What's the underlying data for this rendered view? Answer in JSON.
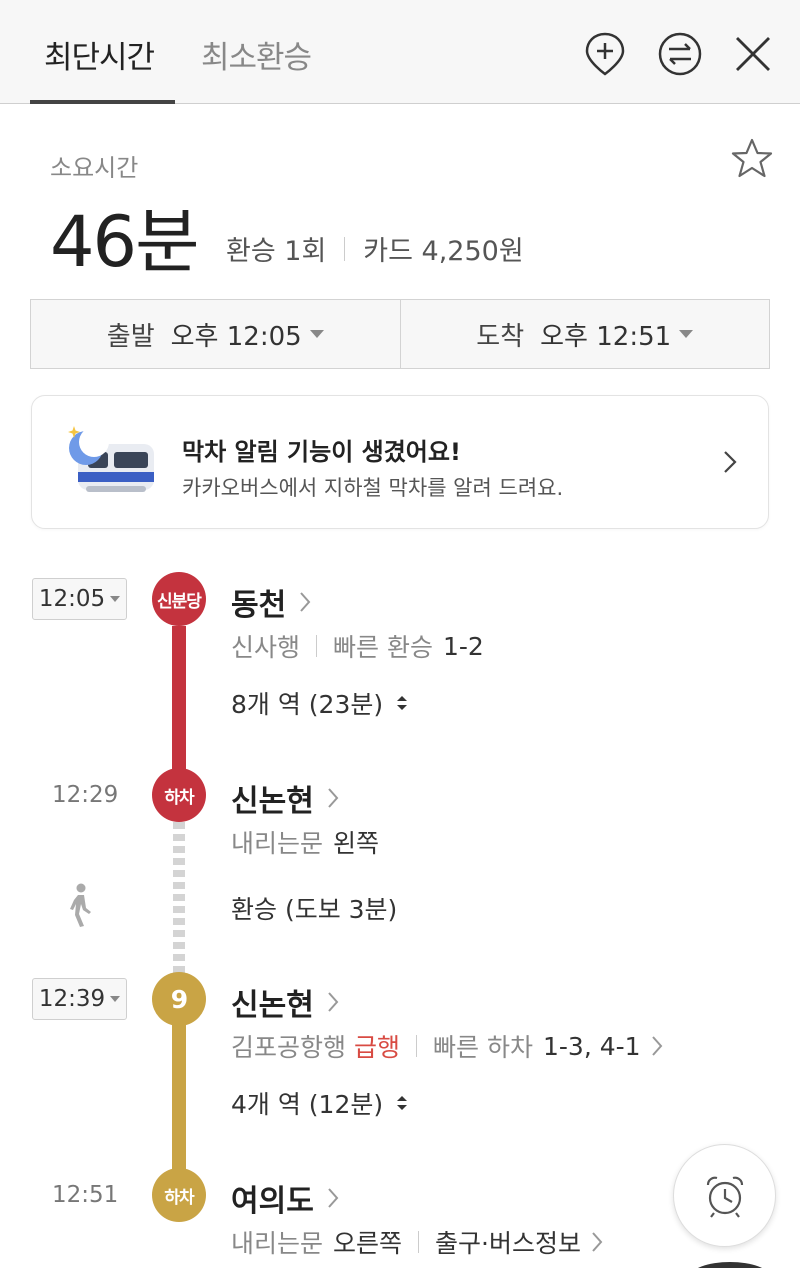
{
  "tabs": [
    {
      "label": "최단시간",
      "active": true
    },
    {
      "label": "최소환승",
      "active": false
    }
  ],
  "header_icons": [
    "add-location-icon",
    "swap-icon",
    "close-icon"
  ],
  "summary": {
    "duration_label": "소요시간",
    "duration": "46분",
    "transfers": "환승 1회",
    "fare": "카드 4,250원"
  },
  "time_select": {
    "depart_label": "출발",
    "depart_time": "오후 12:05",
    "arrive_label": "도착",
    "arrive_time": "오후 12:51"
  },
  "banner": {
    "title": "막차 알림 기능이 생겼어요!",
    "subtitle": "카카오버스에서 지하철 막차를 알려 드려요."
  },
  "route": {
    "leg1": {
      "time": "12:05",
      "line_badge": "신분당",
      "station": "동천",
      "direction": "신사행",
      "fast_label": "빠른 환승",
      "fast_value": "1-2",
      "stops": "8개 역 (23분)",
      "color": "#c4333e"
    },
    "alight1": {
      "time": "12:29",
      "badge": "하차",
      "station": "신논현",
      "door_label": "내리는문",
      "door_value": "왼쪽"
    },
    "transfer": {
      "text": "환승 (도보 3분)"
    },
    "leg2": {
      "time": "12:39",
      "line_badge": "9",
      "station": "신논현",
      "direction": "김포공항행",
      "express": "급행",
      "fast_label": "빠른 하차",
      "fast_value": "1-3, 4-1",
      "stops": "4개 역 (12분)",
      "color": "#c9a445"
    },
    "alight2": {
      "time": "12:51",
      "badge": "하차",
      "station": "여의도",
      "door_label": "내리는문",
      "door_value": "오른쪽",
      "exit_info": "출구·버스정보"
    }
  }
}
